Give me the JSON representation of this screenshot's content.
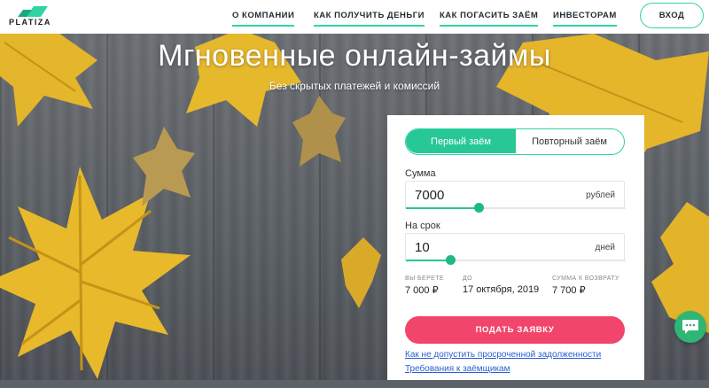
{
  "brand": {
    "name": "PLATIZA",
    "accent": "#2fd4a5",
    "cta": "#f2456b"
  },
  "nav": {
    "items": [
      "О КОМПАНИИ",
      "КАК ПОЛУЧИТЬ ДЕНЬГИ",
      "КАК ПОГАСИТЬ ЗАЁМ",
      "ИНВЕСТОРАМ"
    ],
    "login_label": "ВХОД"
  },
  "hero": {
    "title": "Мгновенные онлайн-займы",
    "subtitle": "Без скрытых платежей и комиссий"
  },
  "form": {
    "tabs": [
      {
        "label": "Первый заём",
        "active": true
      },
      {
        "label": "Повторный заём",
        "active": false
      }
    ],
    "amount": {
      "label": "Сумма",
      "value": "7000",
      "unit": "рублей",
      "slider_fraction": 0.33
    },
    "term": {
      "label": "На срок",
      "value": "10",
      "unit": "дней",
      "slider_fraction": 0.2
    },
    "summary": [
      {
        "caption": "ВЫ БЕРЕТЕ",
        "value": "7 000 ₽"
      },
      {
        "caption": "ДО",
        "value": "17 октября, 2019"
      },
      {
        "caption": "СУММА К ВОЗВРАТУ",
        "value": "7 700 ₽"
      }
    ],
    "submit_label": "ПОДАТЬ ЗАЯВКУ",
    "links": [
      "Как не допустить просроченной задолженности",
      "Требования к заёмщикам"
    ]
  },
  "icons": {
    "chat": "chat-bubble-icon",
    "logo": "platiza-logo-icon"
  }
}
